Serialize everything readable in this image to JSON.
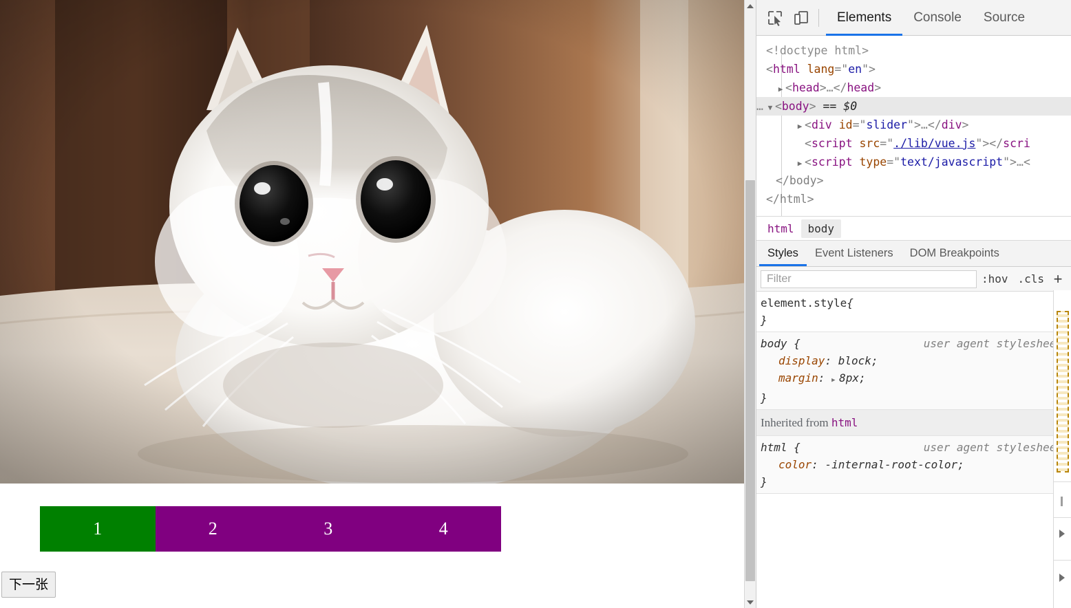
{
  "page": {
    "image_alt": "white fluffy kitten lying on carpet",
    "slider": {
      "tabs": [
        {
          "label": "1",
          "active": true
        },
        {
          "label": "2",
          "active": false
        },
        {
          "label": "3",
          "active": false
        },
        {
          "label": "4",
          "active": false
        }
      ],
      "active_color": "#008000",
      "inactive_color": "#800080"
    },
    "next_button_label": "下一张"
  },
  "devtools": {
    "toolbar": {
      "inspect_icon": "inspect-cursor-icon",
      "device_icon": "device-toolbar-icon",
      "tabs": [
        {
          "label": "Elements",
          "active": true
        },
        {
          "label": "Console",
          "active": false
        },
        {
          "label": "Source",
          "active": false
        }
      ]
    },
    "dom": {
      "rows": [
        {
          "id": "doctype",
          "text": "<!doctype html>"
        },
        {
          "id": "html_open",
          "tag": "html",
          "attr": "lang",
          "value": "en"
        },
        {
          "id": "head",
          "tag": "head",
          "collapsed": true
        },
        {
          "id": "body",
          "tag": "body",
          "selected": true,
          "marker": "== $0"
        },
        {
          "id": "div_slider",
          "tag": "div",
          "attr": "id",
          "value": "slider",
          "collapsed": true
        },
        {
          "id": "script_vue",
          "tag": "script",
          "attr": "src",
          "value": "./lib/vue.js",
          "is_link": true
        },
        {
          "id": "script_inline",
          "tag": "script",
          "attr": "type",
          "value": "text/javascript",
          "collapsed": true
        },
        {
          "id": "body_close",
          "text": "</body>"
        },
        {
          "id": "html_close",
          "text": "</html>"
        }
      ],
      "literals": {
        "doctype": "<!doctype html>",
        "ellipsis": "…",
        "body_marker": "== $0",
        "dots": "…"
      }
    },
    "breadcrumb": [
      {
        "label": "html",
        "active": false
      },
      {
        "label": "body",
        "active": true
      }
    ],
    "style_tabs": [
      {
        "label": "Styles",
        "active": true
      },
      {
        "label": "Event Listeners",
        "active": false
      },
      {
        "label": "DOM Breakpoints",
        "active": false
      }
    ],
    "filter": {
      "placeholder": "Filter",
      "value": "",
      "hov_label": ":hov",
      "cls_label": ".cls",
      "plus_label": "+"
    },
    "rules": [
      {
        "selector": "element.style",
        "origin": "",
        "declarations": [],
        "open_brace": "{",
        "close_brace": "}"
      },
      {
        "selector": "body",
        "origin": "user agent stylesheet",
        "declarations": [
          {
            "prop": "display",
            "value": "block",
            "expandable": false
          },
          {
            "prop": "margin",
            "value": "8px",
            "expandable": true
          }
        ],
        "open_brace": "{",
        "close_brace": "}"
      }
    ],
    "inherited_header": {
      "prefix": "Inherited from",
      "tag": "html"
    },
    "inherited_rules": [
      {
        "selector": "html",
        "origin": "user agent stylesheet",
        "declarations": [
          {
            "prop": "color",
            "value": "-internal-root-color",
            "expandable": false
          }
        ],
        "open_brace": "{",
        "close_brace": "}"
      }
    ]
  }
}
